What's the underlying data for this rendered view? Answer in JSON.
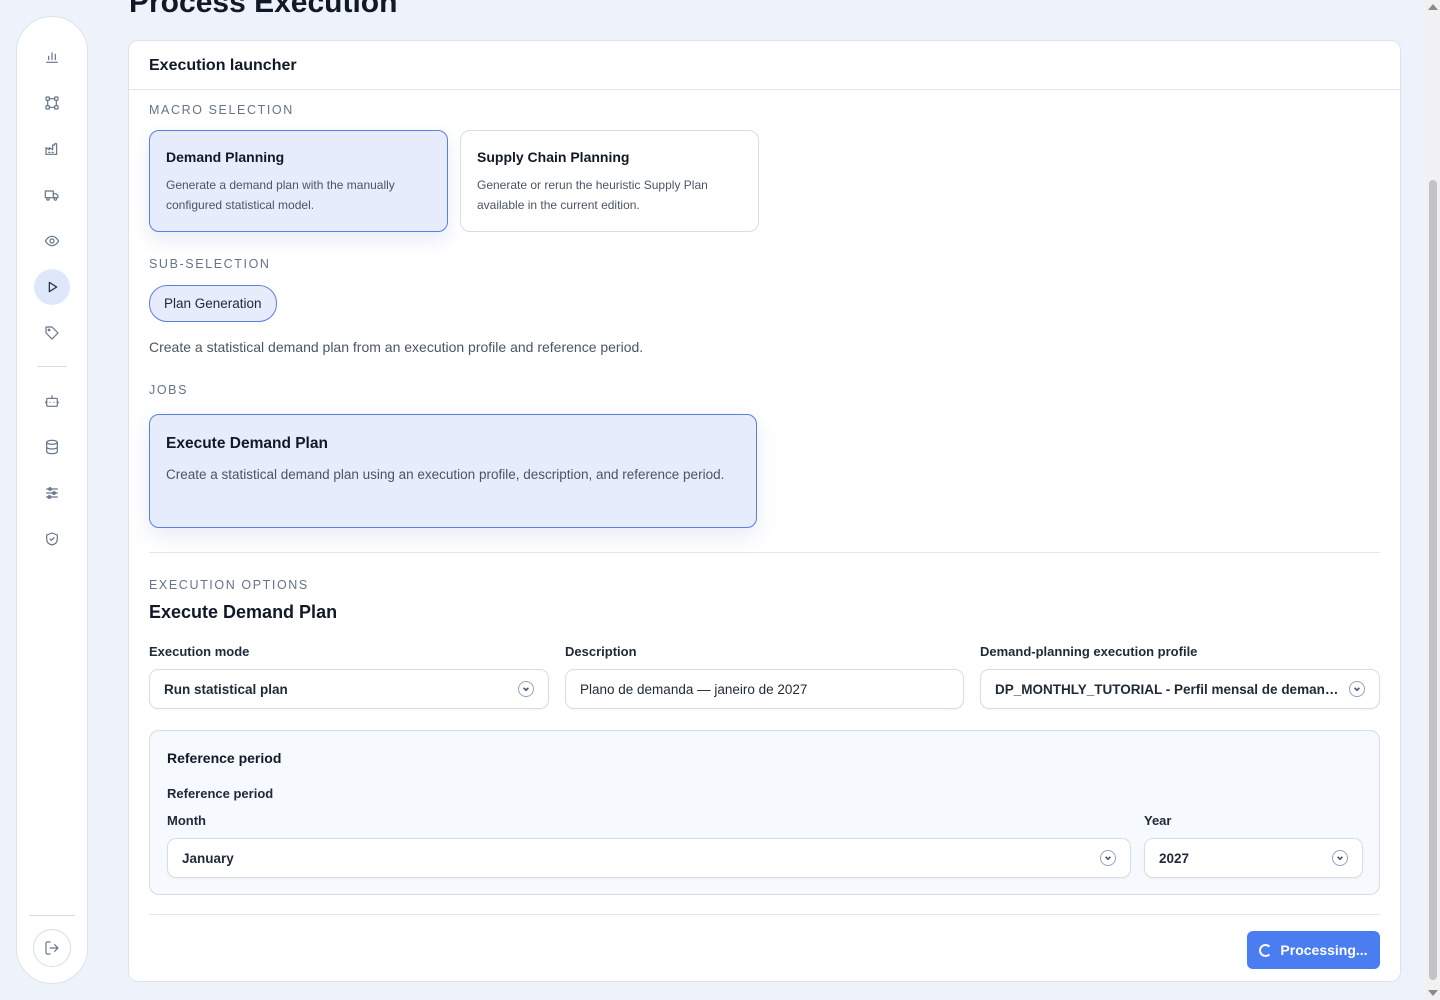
{
  "page": {
    "title": "Process Execution"
  },
  "sidebar": {
    "items": [
      {
        "icon": "bar-chart-icon"
      },
      {
        "icon": "workflow-icon"
      },
      {
        "icon": "factory-icon"
      },
      {
        "icon": "truck-icon"
      },
      {
        "icon": "eye-icon"
      },
      {
        "icon": "play-icon",
        "active": true
      },
      {
        "icon": "tag-icon"
      },
      {
        "icon": "bot-icon"
      },
      {
        "icon": "database-icon"
      },
      {
        "icon": "sliders-icon"
      },
      {
        "icon": "shield-check-icon"
      }
    ],
    "logout_icon": "logout-icon"
  },
  "launcher": {
    "title": "Execution launcher",
    "macro_label": "Macro selection",
    "macros": [
      {
        "title": "Demand Planning",
        "desc": "Generate a demand plan with the manually configured statistical model.",
        "selected": true
      },
      {
        "title": "Supply Chain Planning",
        "desc": "Generate or rerun the heuristic Supply Plan available in the current edition.",
        "selected": false
      }
    ],
    "sub_label": "Sub-selection",
    "sub_chip": "Plan Generation",
    "sub_desc": "Create a statistical demand plan from an execution profile and reference period.",
    "jobs_label": "Jobs",
    "job": {
      "title": "Execute Demand Plan",
      "desc": "Create a statistical demand plan using an execution profile, description, and reference period."
    }
  },
  "options": {
    "label": "Execution options",
    "heading": "Execute Demand Plan",
    "mode_label": "Execution mode",
    "mode_value": "Run statistical plan",
    "desc_label": "Description",
    "desc_value": "Plano de demanda — janeiro de 2027",
    "profile_label": "Demand-planning execution profile",
    "profile_value": "DP_MONTHLY_TUTORIAL - Perfil mensal de demanda",
    "ref_title": "Reference period",
    "ref_sub": "Reference period",
    "month_label": "Month",
    "month_value": "January",
    "year_label": "Year",
    "year_value": "2027"
  },
  "actions": {
    "processing_label": "Processing..."
  },
  "colors": {
    "accent": "#4a7df0",
    "selected_bg": "#e6ecfc",
    "page_bg": "#eef2fa"
  }
}
